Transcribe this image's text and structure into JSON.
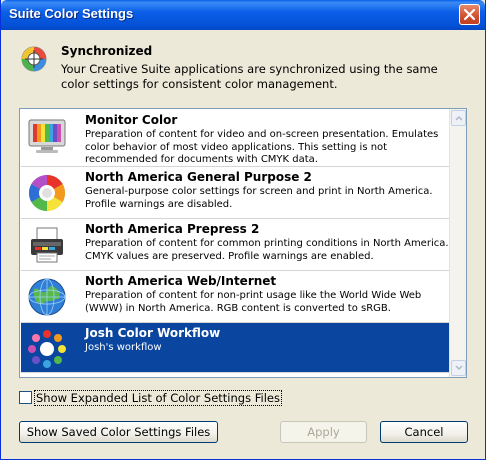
{
  "window": {
    "title": "Suite Color Settings"
  },
  "header": {
    "title": "Synchronized",
    "description": "Your Creative Suite applications are synchronized using the same color settings for consistent color management."
  },
  "settings_list": {
    "items": [
      {
        "name": "Monitor Color",
        "description": "Preparation of content for video and on-screen presentation. Emulates color behavior of most video applications. This setting is not recommended for documents with CMYK data.",
        "icon": "monitor-icon",
        "selected": false
      },
      {
        "name": "North America General Purpose 2",
        "description": "General-purpose color settings for screen and print in North America. Profile warnings are disabled.",
        "icon": "color-wheel-icon",
        "selected": false
      },
      {
        "name": "North America Prepress 2",
        "description": "Preparation of content for common printing conditions in North America. CMYK values are preserved. Profile warnings are enabled.",
        "icon": "printer-icon",
        "selected": false
      },
      {
        "name": "North America Web/Internet",
        "description": "Preparation of content for non-print usage like the World Wide Web (WWW) in North America. RGB content is converted to sRGB.",
        "icon": "globe-icon",
        "selected": false
      },
      {
        "name": "Josh Color Workflow",
        "description": "Josh's workflow",
        "icon": "custom-color-icon",
        "selected": true
      }
    ]
  },
  "options": {
    "show_expanded_label": "Show Expanded List of Color Settings Files",
    "show_expanded_checked": false
  },
  "buttons": {
    "show_saved": "Show Saved Color Settings Files",
    "apply": "Apply",
    "cancel": "Cancel"
  },
  "colors": {
    "titlebar": "#0a5fe8",
    "selection": "#0a46a0",
    "dialog_bg": "#ece9d8",
    "close_button": "#d0502f"
  }
}
